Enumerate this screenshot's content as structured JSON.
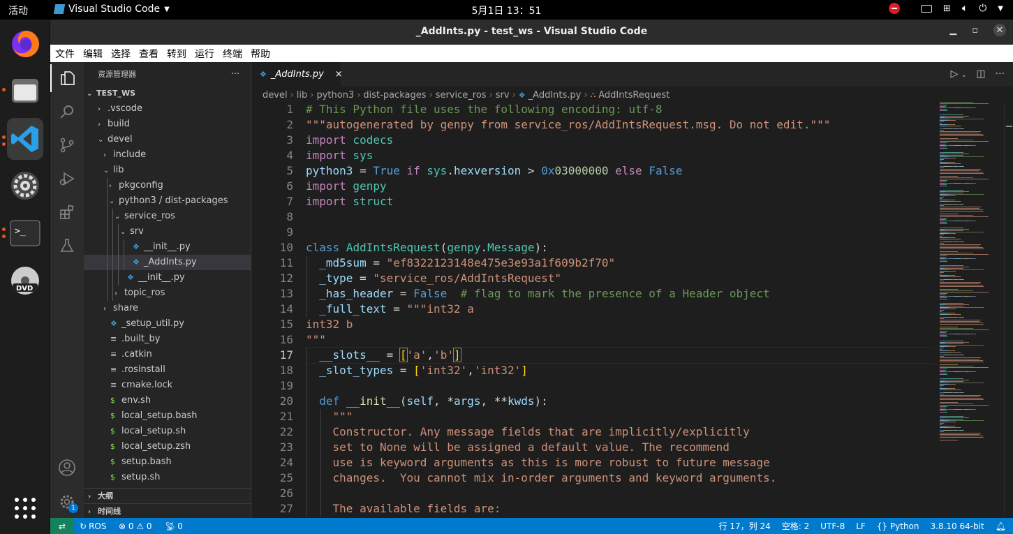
{
  "topbar": {
    "activities": "活动",
    "app_name": "Visual Studio Code",
    "clock": "5月1日  13：51"
  },
  "window": {
    "title": "_AddInts.py - test_ws - Visual Studio Code"
  },
  "menu": [
    "文件",
    "编辑",
    "选择",
    "查看",
    "转到",
    "运行",
    "终端",
    "帮助"
  ],
  "sidebar": {
    "title": "资源管理器",
    "more": "···",
    "workspace": "TEST_WS",
    "tree": [
      {
        "label": ".vscode",
        "kind": "folder",
        "open": false,
        "level": 1
      },
      {
        "label": "build",
        "kind": "folder",
        "open": false,
        "level": 1
      },
      {
        "label": "devel",
        "kind": "folder",
        "open": true,
        "level": 1
      },
      {
        "label": "include",
        "kind": "folder",
        "open": false,
        "level": 2
      },
      {
        "label": "lib",
        "kind": "folder",
        "open": true,
        "level": 2
      },
      {
        "label": "pkgconfig",
        "kind": "folder",
        "open": false,
        "level": 3
      },
      {
        "label": "python3 / dist-packages",
        "kind": "folder",
        "open": true,
        "level": 3
      },
      {
        "label": "service_ros",
        "kind": "folder",
        "open": true,
        "level": 4
      },
      {
        "label": "srv",
        "kind": "folder",
        "open": true,
        "level": 5
      },
      {
        "label": "__init__.py",
        "kind": "py",
        "level": 6
      },
      {
        "label": "_AddInts.py",
        "kind": "py",
        "level": 6,
        "selected": true
      },
      {
        "label": "__init__.py",
        "kind": "py",
        "level": 5
      },
      {
        "label": "topic_ros",
        "kind": "folder",
        "open": false,
        "level": 4
      },
      {
        "label": "share",
        "kind": "folder",
        "open": false,
        "level": 2
      },
      {
        "label": "_setup_util.py",
        "kind": "py",
        "level": 2
      },
      {
        "label": ".built_by",
        "kind": "txt",
        "level": 2
      },
      {
        "label": ".catkin",
        "kind": "txt",
        "level": 2
      },
      {
        "label": ".rosinstall",
        "kind": "txt",
        "level": 2
      },
      {
        "label": "cmake.lock",
        "kind": "txt",
        "level": 2
      },
      {
        "label": "env.sh",
        "kind": "sh",
        "level": 2
      },
      {
        "label": "local_setup.bash",
        "kind": "sh",
        "level": 2
      },
      {
        "label": "local_setup.sh",
        "kind": "sh",
        "level": 2
      },
      {
        "label": "local_setup.zsh",
        "kind": "sh",
        "level": 2
      },
      {
        "label": "setup.bash",
        "kind": "sh",
        "level": 2
      },
      {
        "label": "setup.sh",
        "kind": "sh",
        "level": 2
      }
    ],
    "outline": "大纲",
    "timeline": "时间线"
  },
  "tab": {
    "label": "_AddInts.py",
    "close": "×"
  },
  "breadcrumbs": [
    "devel",
    "lib",
    "python3",
    "dist-packages",
    "service_ros",
    "srv",
    "_AddInts.py",
    "AddIntsRequest"
  ],
  "editor": {
    "current_line": 17,
    "line_numbers": [
      "1",
      "2",
      "3",
      "4",
      "5",
      "6",
      "7",
      "8",
      "9",
      "10",
      "11",
      "12",
      "13",
      "14",
      "15",
      "16",
      "17",
      "18",
      "19",
      "20",
      "21",
      "22",
      "23",
      "24",
      "25",
      "26",
      "27"
    ],
    "lines": [
      [
        [
          "# This Python file uses the following encoding: utf-8",
          "com"
        ]
      ],
      [
        [
          "\"\"\"autogenerated by genpy from service_ros/AddIntsRequest.msg. Do not edit.\"\"\"",
          "str"
        ]
      ],
      [
        [
          "import",
          "kw"
        ],
        [
          " codecs",
          "cls"
        ]
      ],
      [
        [
          "import",
          "kw"
        ],
        [
          " sys",
          "cls"
        ]
      ],
      [
        [
          "python3",
          "var"
        ],
        [
          " = ",
          ""
        ],
        [
          "True",
          "blu"
        ],
        [
          " if ",
          "kw"
        ],
        [
          "sys",
          "cls"
        ],
        [
          ".",
          ""
        ],
        [
          "hexversion",
          "var"
        ],
        [
          " > ",
          ""
        ],
        [
          "0x",
          "blu"
        ],
        [
          "03000000",
          "num"
        ],
        [
          " else ",
          "kw"
        ],
        [
          "False",
          "blu"
        ]
      ],
      [
        [
          "import",
          "kw"
        ],
        [
          " genpy",
          "cls"
        ]
      ],
      [
        [
          "import",
          "kw"
        ],
        [
          " struct",
          "cls"
        ]
      ],
      [],
      [],
      [
        [
          "class",
          "blu"
        ],
        [
          " ",
          ""
        ],
        [
          "AddIntsRequest",
          "cls"
        ],
        [
          "(",
          ""
        ],
        [
          "genpy",
          "cls"
        ],
        [
          ".",
          ""
        ],
        [
          "Message",
          "cls"
        ],
        [
          "):",
          ""
        ]
      ],
      [
        [
          "  _md5sum",
          "var"
        ],
        [
          " = ",
          ""
        ],
        [
          "\"ef8322123148e475e3e93a1f609b2f70\"",
          "str"
        ]
      ],
      [
        [
          "  _type",
          "var"
        ],
        [
          " = ",
          ""
        ],
        [
          "\"service_ros/AddIntsRequest\"",
          "str"
        ]
      ],
      [
        [
          "  _has_header",
          "var"
        ],
        [
          " = ",
          ""
        ],
        [
          "False",
          "blu"
        ],
        [
          "  # flag to mark the presence of a Header object",
          "com"
        ]
      ],
      [
        [
          "  _full_text",
          "var"
        ],
        [
          " = ",
          ""
        ],
        [
          "\"\"\"int32 a",
          "str"
        ]
      ],
      [
        [
          "int32 b",
          "str"
        ]
      ],
      [
        [
          "\"\"\"",
          "str"
        ]
      ],
      [
        [
          "  __slots__",
          "var"
        ],
        [
          " = ",
          ""
        ],
        [
          "[",
          "br"
        ],
        [
          "'a'",
          "str"
        ],
        [
          ",",
          ""
        ],
        [
          "'b'",
          "str"
        ],
        [
          "]",
          "br"
        ]
      ],
      [
        [
          "  _slot_types",
          "var"
        ],
        [
          " = ",
          ""
        ],
        [
          "[",
          "br"
        ],
        [
          "'int32'",
          "str"
        ],
        [
          ",",
          ""
        ],
        [
          "'int32'",
          "str"
        ],
        [
          "]",
          "br"
        ]
      ],
      [],
      [
        [
          "  def",
          "blu"
        ],
        [
          " ",
          ""
        ],
        [
          "__init__",
          "fn"
        ],
        [
          "(",
          ""
        ],
        [
          "self",
          "var"
        ],
        [
          ", *",
          ""
        ],
        [
          "args",
          "var"
        ],
        [
          ", **",
          ""
        ],
        [
          "kwds",
          "var"
        ],
        [
          "):",
          ""
        ]
      ],
      [
        [
          "    \"\"\"",
          "str"
        ]
      ],
      [
        [
          "    Constructor. Any message fields that are implicitly/explicitly",
          "str"
        ]
      ],
      [
        [
          "    set to None will be assigned a default value. The recommend",
          "str"
        ]
      ],
      [
        [
          "    use is keyword arguments as this is more robust to future message",
          "str"
        ]
      ],
      [
        [
          "    changes.  You cannot mix in-order arguments and keyword arguments.",
          "str"
        ]
      ],
      [],
      [
        [
          "    The available fields are:",
          "str"
        ]
      ]
    ]
  },
  "status": {
    "remote_icon": "⇄",
    "ros": "ROS",
    "problems": "⊗ 0 ⚠ 0",
    "ports": "0",
    "position": "行 17，列 24",
    "spaces": "空格: 2",
    "encoding": "UTF-8",
    "eol": "LF",
    "language": "Python",
    "interpreter": "3.8.10 64-bit"
  },
  "activity_badge": "1",
  "colors": {
    "accent": "#007acc",
    "selection": "#37373d",
    "ubuntu": "#e95420"
  }
}
